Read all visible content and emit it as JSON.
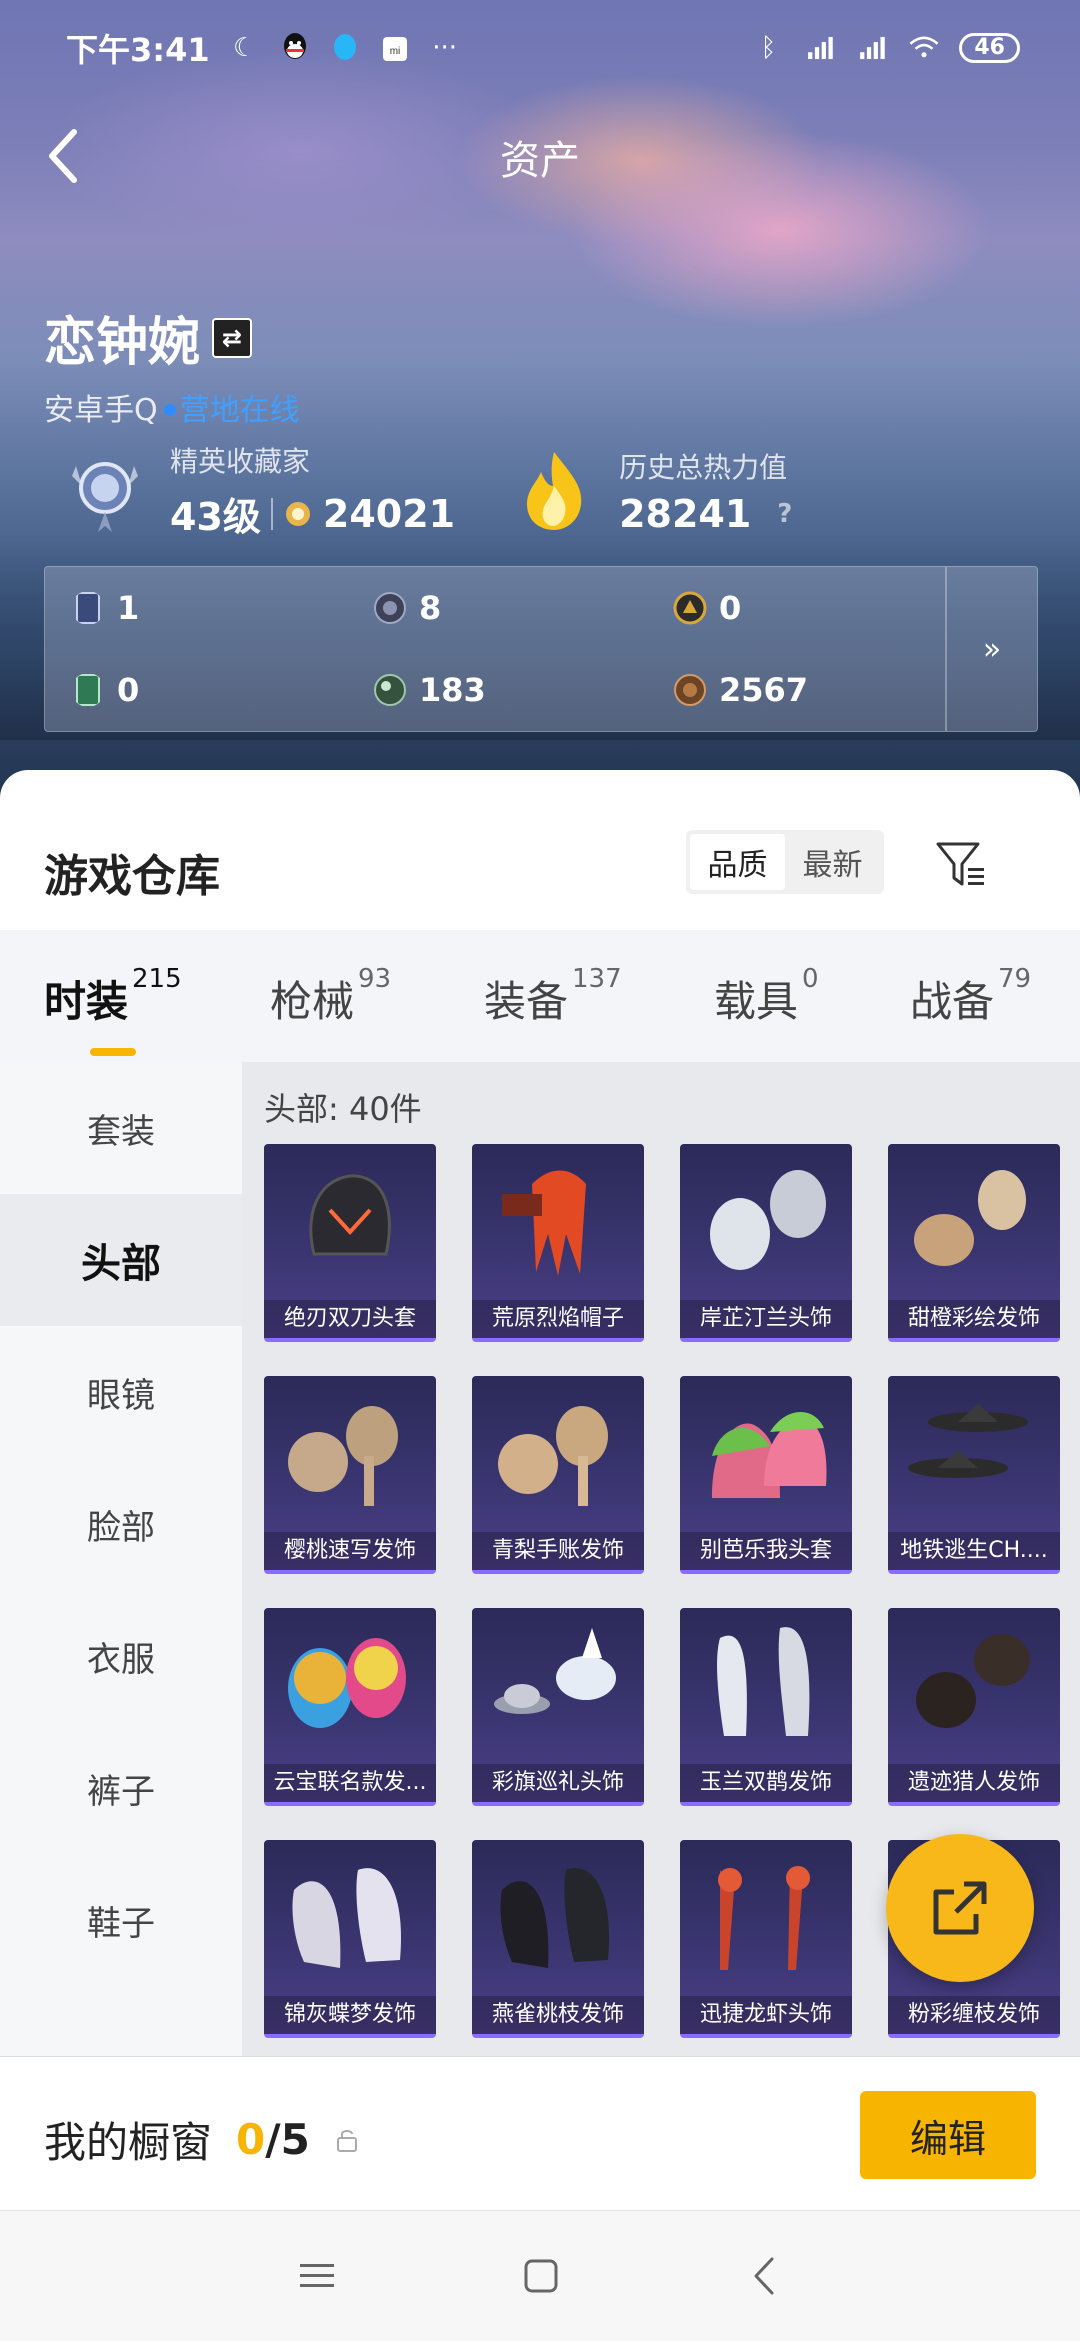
{
  "status_bar": {
    "time": "下午3:41",
    "battery": "46"
  },
  "header": {
    "title": "资产"
  },
  "user": {
    "name": "恋钟婉",
    "platform": "安卓手Q",
    "online_text": "营地在线"
  },
  "collector": {
    "label": "精英收藏家",
    "level": "43级",
    "points": "24021"
  },
  "heat": {
    "label": "历史总热力值",
    "value": "28241",
    "help": "?"
  },
  "assets": {
    "items": [
      {
        "icon": "card-icon",
        "value": "1"
      },
      {
        "icon": "coin-gray-icon",
        "value": "8"
      },
      {
        "icon": "coin-gold-icon",
        "value": "0"
      },
      {
        "icon": "ticket-icon",
        "value": "0"
      },
      {
        "icon": "orb-green-icon",
        "value": "183"
      },
      {
        "icon": "coin-bronze-icon",
        "value": "2567"
      }
    ],
    "more": "»"
  },
  "warehouse": {
    "title": "游戏仓库",
    "sort": {
      "options": [
        "品质",
        "最新"
      ],
      "selected": "品质"
    }
  },
  "tabs": [
    {
      "label": "时装",
      "count": "215"
    },
    {
      "label": "枪械",
      "count": "93"
    },
    {
      "label": "装备",
      "count": "137"
    },
    {
      "label": "载具",
      "count": "0"
    },
    {
      "label": "战备",
      "count": "79"
    }
  ],
  "categories": [
    "套装",
    "头部",
    "眼镜",
    "脸部",
    "衣服",
    "裤子",
    "鞋子"
  ],
  "selected_category": "头部",
  "grid": {
    "header": "头部: 40件",
    "items": [
      "绝刃双刀头套",
      "荒原烈焰帽子",
      "岸芷汀兰头饰",
      "甜橙彩绘发饰",
      "樱桃速写发饰",
      "青梨手账发饰",
      "别芭乐我头套",
      "地铁逃生CH....",
      "云宝联名款发...",
      "彩旗巡礼头饰",
      "玉兰双鹊发饰",
      "遗迹猎人发饰",
      "锦灰蝶梦发饰",
      "燕雀桃枝发饰",
      "迅捷龙虾头饰",
      "粉彩缠枝发饰"
    ]
  },
  "showcase": {
    "label": "我的橱窗",
    "current": "0",
    "total": "/5",
    "edit_label": "编辑"
  },
  "colors": {
    "accent": "#f7b400",
    "online": "#3fa0ff",
    "card_bg": "#3a3570"
  }
}
